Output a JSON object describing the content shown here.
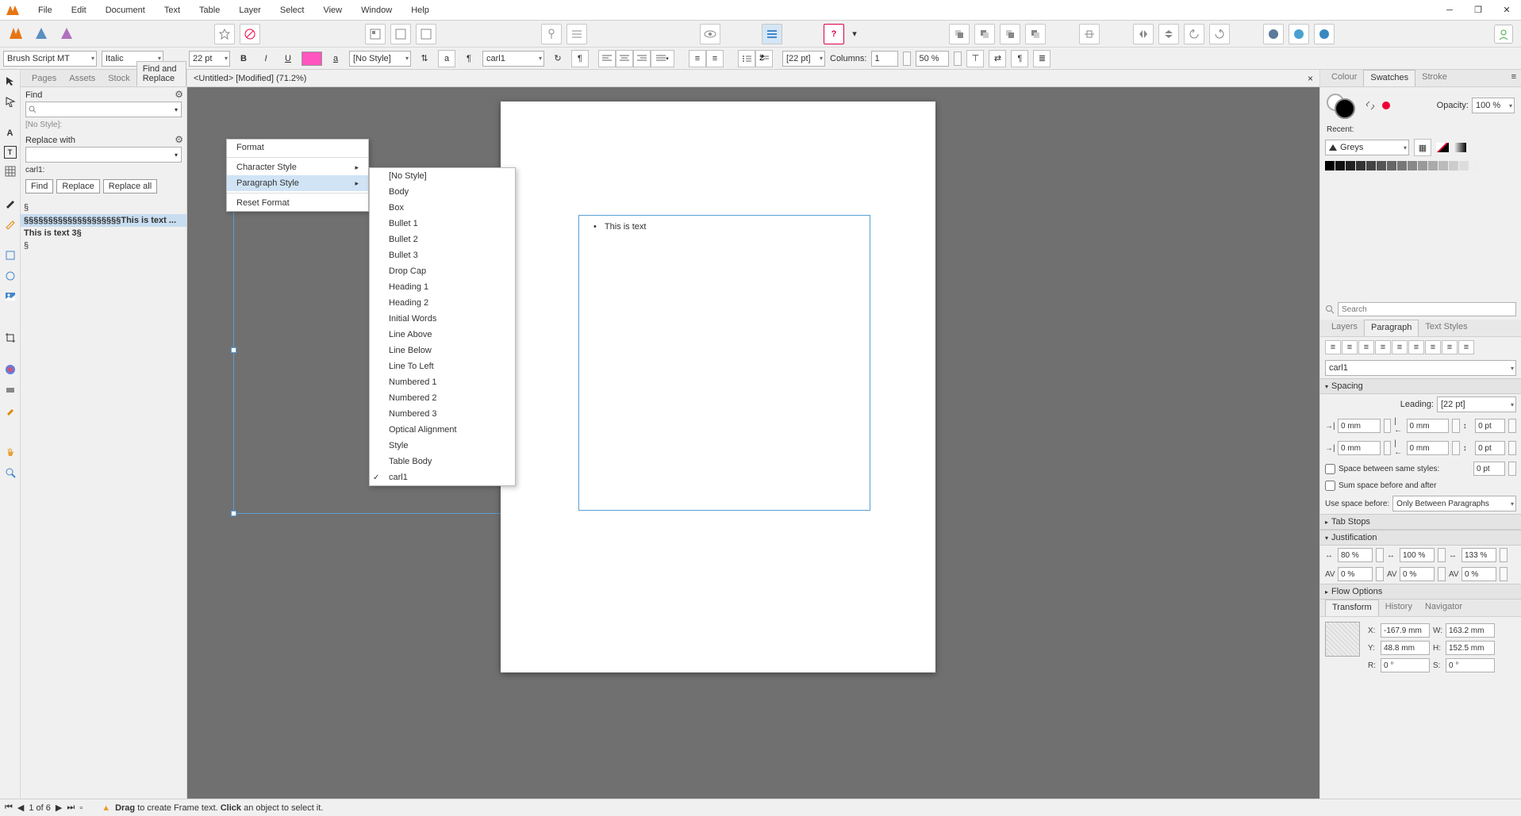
{
  "menu": {
    "items": [
      "File",
      "Edit",
      "Document",
      "Text",
      "Table",
      "Layer",
      "Select",
      "View",
      "Window",
      "Help"
    ]
  },
  "toolbar2": {
    "font": "Brush Script MT",
    "font_style": "Italic",
    "font_size": "22 pt",
    "char_style": "[No Style]",
    "para_style": "carl1",
    "leading": "[22 pt]",
    "columns_label": "Columns:",
    "columns_val": "1",
    "columns_pct": "50 %"
  },
  "doc_tab": "<Untitled> [Modified] (71.2%)",
  "left_tabs": [
    "Pages",
    "Assets",
    "Stock",
    "Find and Replace"
  ],
  "find": {
    "find_label": "Find",
    "no_style": "[No Style]:",
    "replace_label": "Replace with",
    "style_name": "carl1:",
    "find_btn": "Find",
    "replace_btn": "Replace",
    "replace_all_btn": "Replace all",
    "result0": "§",
    "result1": "§§§§§§§§§§§§§§§§§§§§This is text ...",
    "result2": "This is text 3§",
    "result3": "§"
  },
  "context1": {
    "format": "Format",
    "char": "Character Style",
    "para": "Paragraph Style",
    "reset": "Reset Format"
  },
  "context2": {
    "items": [
      "[No Style]",
      "Body",
      "Box",
      "Bullet 1",
      "Bullet 2",
      "Bullet 3",
      "Drop Cap",
      "Heading 1",
      "Heading 2",
      "Initial Words",
      "Line Above",
      "Line Below",
      "Line To Left",
      "Numbered 1",
      "Numbered 2",
      "Numbered 3",
      "Optical Alignment",
      "Style",
      "Table Body",
      "carl1"
    ]
  },
  "canvas": {
    "text": "This is text"
  },
  "right": {
    "tabs1": [
      "Colour",
      "Swatches",
      "Stroke"
    ],
    "opacity_label": "Opacity:",
    "opacity_val": "100 %",
    "recent": "Recent:",
    "greys": "Greys",
    "search_ph": "Search",
    "tabs2": [
      "Layers",
      "Paragraph",
      "Text Styles"
    ],
    "para_combo": "carl1",
    "spacing": "Spacing",
    "leading_label": "Leading:",
    "leading_val": "[22 pt]",
    "sp1": "0 mm",
    "sp2": "0 mm",
    "sp3": "0 pt",
    "sp4": "0 mm",
    "sp5": "0 mm",
    "sp6": "0 pt",
    "same_styles": "Space between same styles:",
    "same_val": "0 pt",
    "sum_space": "Sum space before and after",
    "use_space": "Use space before:",
    "use_space_val": "Only Between Paragraphs",
    "tab_stops": "Tab Stops",
    "justification": "Justification",
    "j1": "80 %",
    "j2": "100 %",
    "j3": "133 %",
    "j4": "0 %",
    "j5": "0 %",
    "j6": "0 %",
    "flow": "Flow Options",
    "tabs3": [
      "Transform",
      "History",
      "Navigator"
    ],
    "x_lbl": "X:",
    "x_val": "-167.9 mm",
    "y_lbl": "Y:",
    "y_val": "48.8 mm",
    "w_lbl": "W:",
    "w_val": "163.2 mm",
    "h_lbl": "H:",
    "h_val": "152.5 mm",
    "r_lbl": "R:",
    "r_val": "0 °",
    "s_lbl": "S:",
    "s_val": "0 °"
  },
  "status": {
    "page": "1 of 6",
    "hint_prefix": "Drag",
    "hint_mid": " to create Frame text. ",
    "hint_bold2": "Click",
    "hint_end": " an object to select it."
  }
}
